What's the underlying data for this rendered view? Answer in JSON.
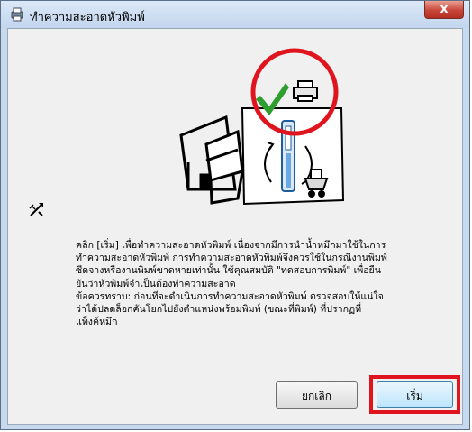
{
  "window": {
    "title": "ทำความสะอาดหัวพิมพ์",
    "close_label": "x"
  },
  "illustration": {
    "icons": [
      "printer-with-ink-tank-icon",
      "checkmark-icon",
      "printer-icon",
      "print-head-nozzle-icon",
      "cart-icon"
    ],
    "highlight_color": "#e0141e",
    "check_color": "#2e9e2e"
  },
  "info": {
    "icon": "tools-icon"
  },
  "description": "คลิก [เริ่ม] เพื่อทำความสะอาดหัวพิมพ์ เนื่องจากมีการนำน้ำหมึกมาใช้ในการ\nทำความสะอาดหัวพิมพ์ การทำความสะอาดหัวพิมพ์จึงควรใช้ในกรณีงานพิมพ์\nซีดจางหรืองานพิมพ์ขาดหายเท่านั้น ใช้คุณสมบัติ \"ทดสอบการพิมพ์\" เพื่อยืน\nยันว่าหัวพิมพ์จำเป็นต้องทำความสะอาด\nข้อควรทราบ: ก่อนที่จะดำเนินการทำความสะอาดหัวพิมพ์ ตรวจสอบให้แน่ใจ\nว่าได้ปลดล็อกคันโยกไปยังตำแหน่งพร้อมพิมพ์ (ขณะที่พิมพ์) ที่ปรากฏที่\nแท็งค์หมึก",
  "buttons": {
    "cancel": "ยกเลิก",
    "start": "เริ่ม"
  }
}
